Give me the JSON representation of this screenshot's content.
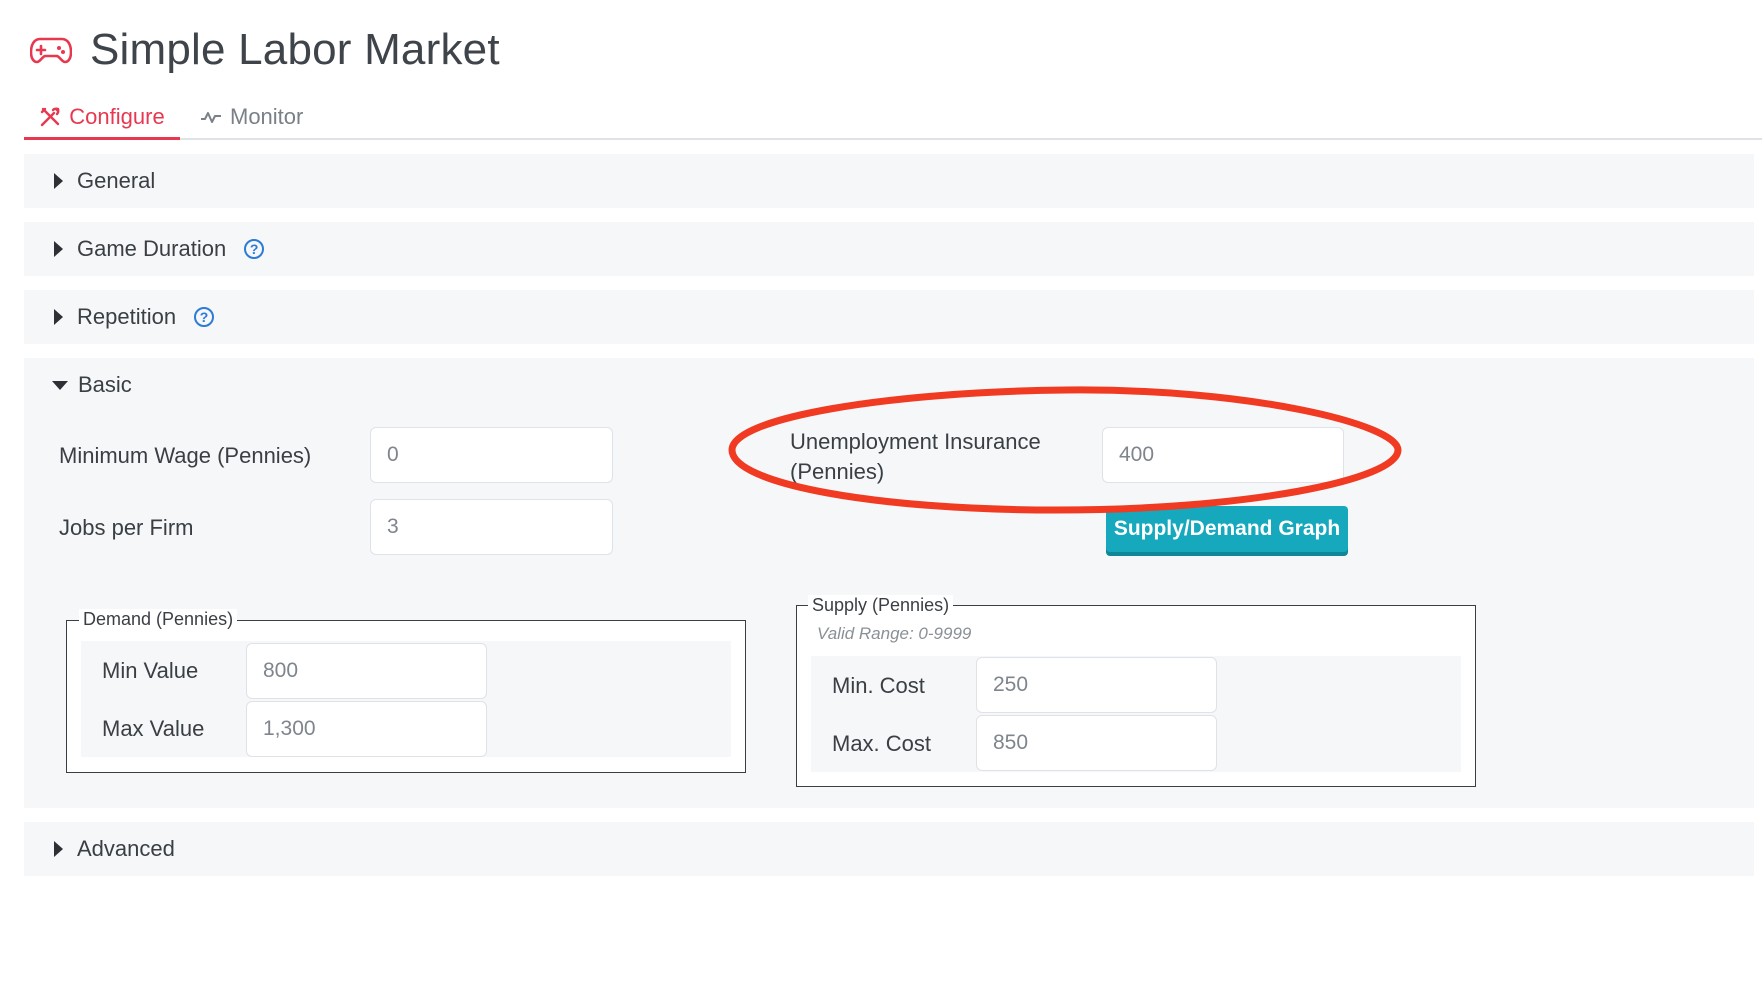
{
  "app": {
    "title": "Simple Labor Market",
    "icon": "gamepad-icon"
  },
  "tabs": [
    {
      "label": "Configure",
      "icon": "tools-icon",
      "active": true
    },
    {
      "label": "Monitor",
      "icon": "activity-icon",
      "active": false
    }
  ],
  "sections": {
    "general": {
      "label": "General",
      "expanded": false
    },
    "game_duration": {
      "label": "Game Duration",
      "expanded": false,
      "help": "?"
    },
    "repetition": {
      "label": "Repetition",
      "expanded": false,
      "help": "?"
    },
    "basic": {
      "label": "Basic",
      "expanded": true
    },
    "advanced": {
      "label": "Advanced",
      "expanded": false
    }
  },
  "basic": {
    "min_wage_label": "Minimum Wage (Pennies)",
    "min_wage_value": "0",
    "jobs_label": "Jobs per Firm",
    "jobs_value": "3",
    "ui_label_line1": "Unemployment Insurance",
    "ui_label_line2": "(Pennies)",
    "ui_value": "400",
    "graph_button": "Supply/Demand Graph"
  },
  "demand": {
    "legend": "Demand (Pennies)",
    "min_label": "Min Value",
    "min_value": "800",
    "max_label": "Max Value",
    "max_value": "1,300"
  },
  "supply": {
    "legend": "Supply (Pennies)",
    "hint": "Valid Range: 0-9999",
    "min_label": "Min. Cost",
    "min_value": "250",
    "max_label": "Max. Cost",
    "max_value": "850"
  },
  "colors": {
    "accent": "#e8384f",
    "button": "#16a8bd",
    "help": "#2c7bd6",
    "annotation": "#f03a22"
  }
}
